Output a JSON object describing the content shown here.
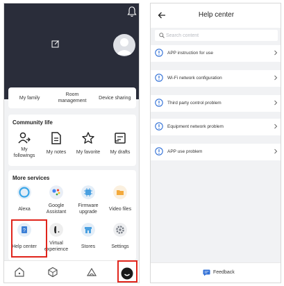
{
  "profile": {
    "quick_actions": [
      {
        "label": "My family"
      },
      {
        "label": "Room\nmanagement"
      },
      {
        "label": "Device sharing"
      }
    ]
  },
  "community": {
    "title": "Community life",
    "items": [
      {
        "label": "My\nfollowings",
        "icon": "person-follow-icon"
      },
      {
        "label": "My notes",
        "icon": "document-icon"
      },
      {
        "label": "My favorite",
        "icon": "star-icon"
      },
      {
        "label": "My drafts",
        "icon": "drafts-icon"
      }
    ]
  },
  "services": {
    "title": "More services",
    "items": [
      {
        "label": "Alexa",
        "icon": "alexa-icon",
        "color": "#3aa6e8"
      },
      {
        "label": "Google\nAssistant",
        "icon": "google-assistant-icon",
        "color": "#4285f4"
      },
      {
        "label": "Firmware\nupgrade",
        "icon": "chip-icon",
        "color": "#4aa0e0"
      },
      {
        "label": "Video files",
        "icon": "folder-icon",
        "color": "#f3a93b"
      },
      {
        "label": "Help center",
        "icon": "help-book-icon",
        "color": "#3b7fd6"
      },
      {
        "label": "Virtual\nexperience",
        "icon": "virtual-device-icon",
        "color": "#333333"
      },
      {
        "label": "Stores",
        "icon": "store-icon",
        "color": "#4aa0e0"
      },
      {
        "label": "Settings",
        "icon": "settings-icon",
        "color": "#7a7f88"
      }
    ],
    "highlighted": "Help center"
  },
  "tabbar": {
    "tabs": [
      {
        "icon": "home-icon"
      },
      {
        "icon": "device-cube-icon"
      },
      {
        "icon": "scene-icon"
      },
      {
        "icon": "me-icon",
        "active": true
      }
    ]
  },
  "help": {
    "title": "Help center",
    "search_placeholder": "Search content",
    "topics": [
      {
        "label": "APP instruction for use"
      },
      {
        "label": "Wi-Fi network configuration"
      },
      {
        "label": "Third party control problem"
      },
      {
        "label": "Equipment network problem"
      },
      {
        "label": "APP use problem"
      }
    ],
    "feedback_label": "Feedback"
  },
  "colors": {
    "hero_bg": "#2a2d3a",
    "accent_blue": "#2f6fd6",
    "highlight_red": "#e0241b"
  }
}
